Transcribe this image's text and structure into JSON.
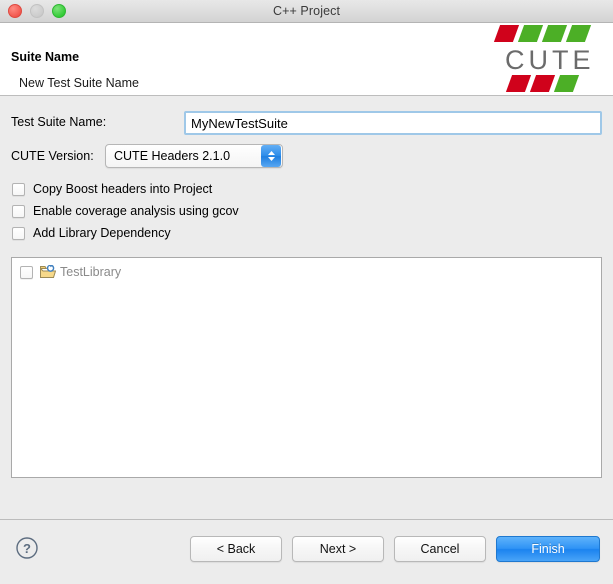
{
  "window": {
    "title": "C++ Project",
    "traffic_lights": [
      "close",
      "minimize",
      "zoom"
    ]
  },
  "header": {
    "title": "Suite Name",
    "subtitle": "New Test Suite Name",
    "logo": {
      "text": "CUTE",
      "top_stripes": [
        "#d0021b",
        "#4caf26",
        "#4caf26",
        "#4caf26"
      ],
      "bottom_stripes": [
        "#d0021b",
        "#d0021b",
        "#4caf26"
      ]
    }
  },
  "form": {
    "suite_name": {
      "label": "Test Suite Name:",
      "value": "MyNewTestSuite",
      "placeholder": ""
    },
    "cute_version": {
      "label": "CUTE Version:",
      "selected": "CUTE Headers 2.1.0",
      "options": [
        "CUTE Headers 2.1.0"
      ]
    },
    "checkboxes": [
      {
        "label": "Copy Boost headers into Project",
        "checked": false
      },
      {
        "label": "Enable coverage analysis using gcov",
        "checked": false
      },
      {
        "label": "Add Library Dependency",
        "checked": false
      }
    ]
  },
  "library_list": {
    "items": [
      {
        "label": "TestLibrary",
        "checked": false,
        "icon": "folder-icon"
      }
    ]
  },
  "footer": {
    "help_label": "?",
    "buttons": [
      {
        "label": "< Back",
        "primary": false
      },
      {
        "label": "Next >",
        "primary": false
      },
      {
        "label": "Cancel",
        "primary": false
      },
      {
        "label": "Finish",
        "primary": true
      }
    ]
  },
  "colors": {
    "accent_blue": "#2f93f5",
    "logo_red": "#d0021b",
    "logo_green": "#4caf26",
    "window_bg": "#ececec",
    "focus_border": "#9fc8e8"
  }
}
